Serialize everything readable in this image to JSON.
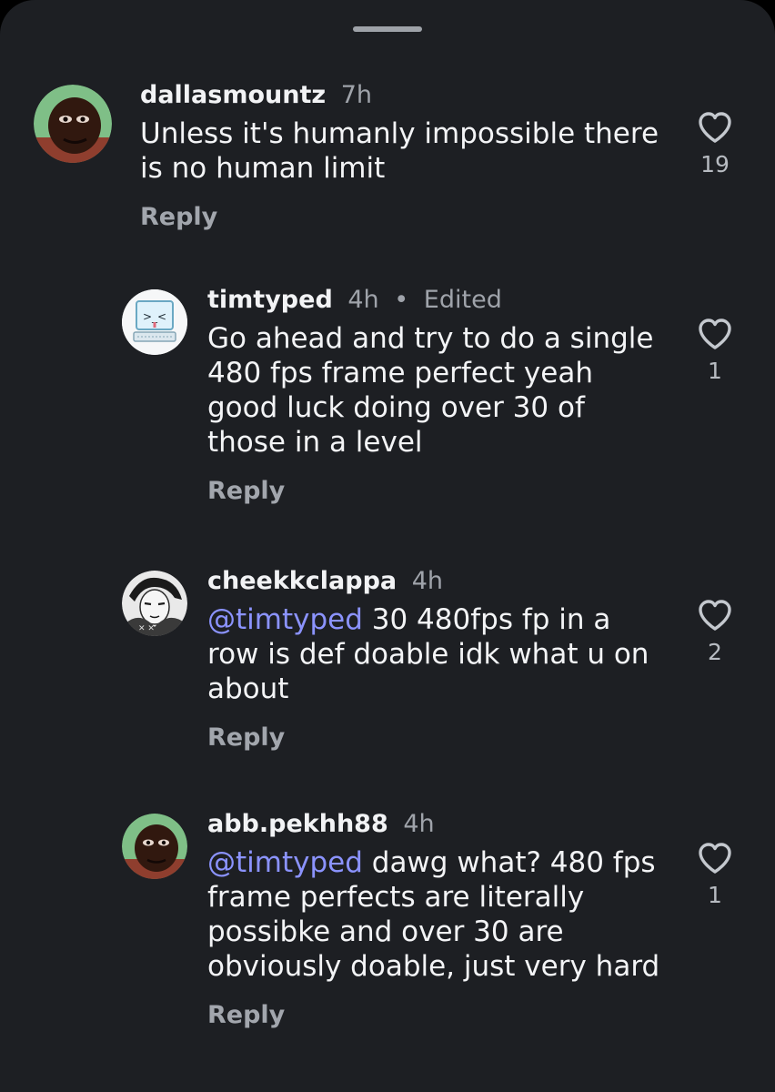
{
  "comments": [
    {
      "username": "dallasmountz",
      "time": "7h",
      "edited": "",
      "mention": "",
      "text": "Unless it's humanly impossible there is no human limit",
      "reply_label": "Reply",
      "likes": "19",
      "avatar": "avatar-photo-person"
    },
    {
      "username": "timtyped",
      "time": "4h",
      "edited": "Edited",
      "mention": "",
      "text": "Go ahead and try to do a single 480 fps frame perfect yeah good luck doing over 30 of those in a level",
      "reply_label": "Reply",
      "likes": "1",
      "avatar": "avatar-computer-face"
    },
    {
      "username": "cheekkclappa",
      "time": "4h",
      "edited": "",
      "mention": "@timtyped",
      "text": " 30 480fps fp in a row is def doable idk what u on about",
      "reply_label": "Reply",
      "likes": "2",
      "avatar": "avatar-anime-drawing"
    },
    {
      "username": "abb.pekhh88",
      "time": "4h",
      "edited": "",
      "mention": "@timtyped",
      "text": " dawg what? 480 fps frame perfects are literally possibke and over 30 are obviously doable, just very hard",
      "reply_label": "Reply",
      "likes": "1",
      "avatar": "avatar-photo-person"
    }
  ],
  "colors": {
    "background": "#1d1f23",
    "text": "#f3f4f6",
    "muted": "#9fa3aa",
    "mention": "#8b93ff"
  },
  "icons": {
    "like": "heart-outline-icon",
    "mention": "threads-at-icon"
  }
}
